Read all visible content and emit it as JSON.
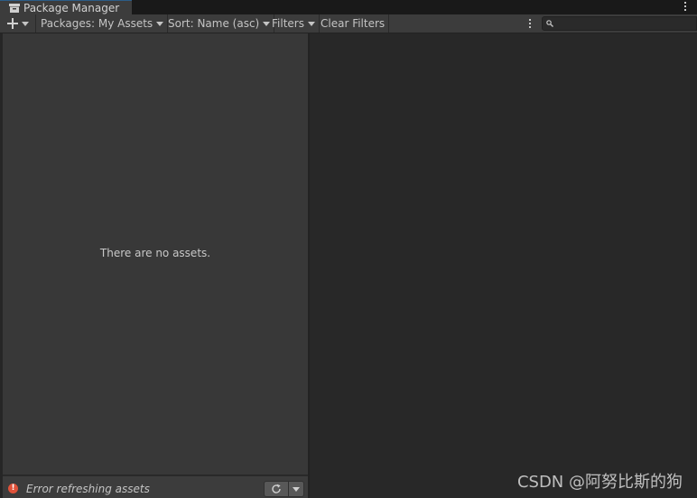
{
  "window": {
    "tab_title": "Package Manager"
  },
  "toolbar": {
    "packages_label": "Packages: My Assets",
    "sort_label": "Sort: Name (asc)",
    "filters_label": "Filters",
    "clear_filters_label": "Clear Filters",
    "search_placeholder": ""
  },
  "list": {
    "empty_message": "There are no assets."
  },
  "status": {
    "message": "Error refreshing assets",
    "error_icon_glyph": "!",
    "error_color": "#e0523a"
  },
  "watermark": {
    "text": "CSDN @阿努比斯的狗"
  },
  "icons": {
    "tab_icon": "package-icon",
    "add": "plus-icon",
    "search": "magnifier-icon",
    "refresh": "refresh-icon"
  }
}
